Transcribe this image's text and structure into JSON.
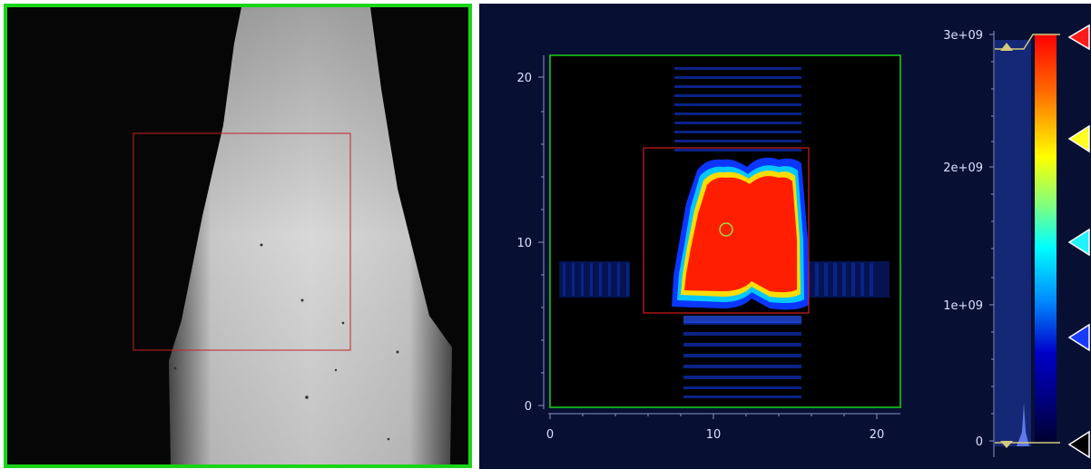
{
  "camera_view": {
    "frame_color": "#19d419",
    "roi_color": "#c72222"
  },
  "plot": {
    "x_ticks": [
      "0",
      "10",
      "20"
    ],
    "y_ticks": [
      "0",
      "10",
      "20"
    ],
    "frame_color": "#19d419",
    "roi_color": "#d31d1d",
    "marker_color": "#8dfa43",
    "background": "#071032"
  },
  "colorbar": {
    "ticks": [
      "3e+09",
      "2e+09",
      "1e+09",
      "0"
    ],
    "handle_colors": [
      "#ff0000",
      "#ffff00",
      "#00f0ff",
      "#0022ff",
      "#000000"
    ],
    "gradient": [
      "#ff0000",
      "#ff6600",
      "#ffff00",
      "#7fff7f",
      "#00ffff",
      "#0088ff",
      "#0000aa",
      "#000040"
    ]
  }
}
